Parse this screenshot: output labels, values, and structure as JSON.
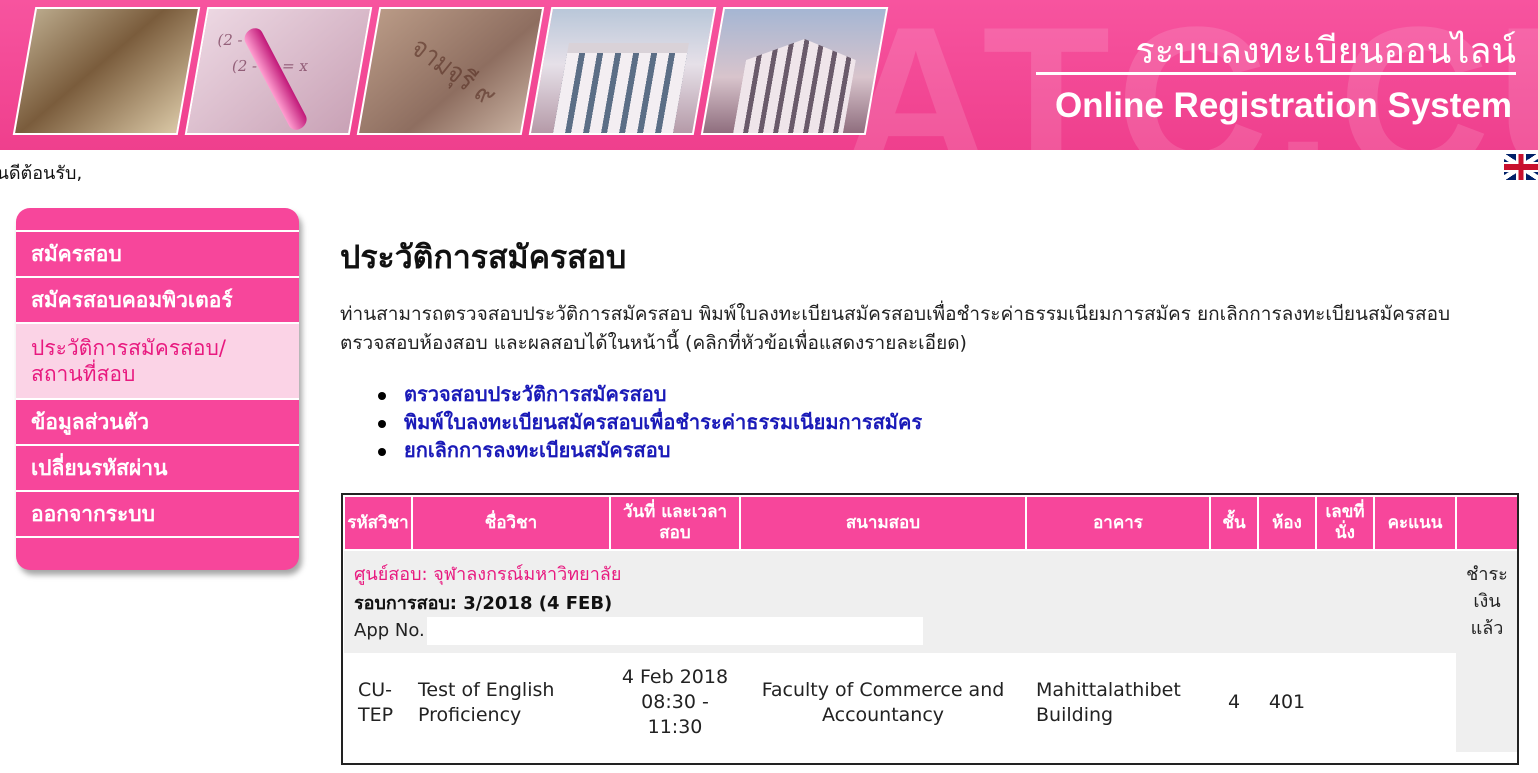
{
  "banner": {
    "bg_text": "ATC.CU",
    "title_th": "ระบบลงทะเบียนออนไลน์",
    "title_en": "Online Registration System",
    "panel_stone_text": "จามจุรี ๙",
    "panel_math_text": "(2 - 5)\n    (2 - 5̅) = x"
  },
  "welcome": "ยินดีต้อนรับ,",
  "language_icon": "uk-flag-icon",
  "sidebar": {
    "items": [
      {
        "label": "สมัครสอบ"
      },
      {
        "label": "สมัครสอบคอมพิวเตอร์"
      },
      {
        "label_line1": "ประวัติการสมัครสอบ/",
        "label_line2": "สถานที่สอบ"
      },
      {
        "label": "ข้อมูลส่วนตัว"
      },
      {
        "label": "เปลี่ยนรหัสผ่าน"
      },
      {
        "label": "ออกจากระบบ"
      }
    ]
  },
  "main": {
    "title": "ประวัติการสมัครสอบ",
    "description": "ท่านสามารถตรวจสอบประวัติการสมัครสอบ พิมพ์ใบลงทะเบียนสมัครสอบเพื่อชำระค่าธรรมเนียมการสมัคร ยกเลิกการลงทะเบียนสมัครสอบ ตรวจสอบห้องสอบ และผลสอบได้ในหน้านี้ (คลิกที่หัวข้อเพื่อแสดงรายละเอียด)",
    "links": [
      "ตรวจสอบประวัติการสมัครสอบ",
      "พิมพ์ใบลงทะเบียนสมัครสอบเพื่อชำระค่าธรรมเนียมการสมัคร",
      "ยกเลิกการลงทะเบียนสมัครสอบ"
    ]
  },
  "table": {
    "headers": {
      "code": "รหัสวิชา",
      "subject": "ชื่อวิชา",
      "datetime": "วันที่ และเวลาสอบ",
      "venue": "สนามสอบ",
      "building": "อาคาร",
      "floor": "ชั้น",
      "room": "ห้อง",
      "seat": "เลขที่นั่ง",
      "score": "คะแนน",
      "extra": ""
    },
    "center": {
      "name": "ศูนย์สอบ: จุฬาลงกรณ์มหาวิทยาลัย",
      "round": "รอบการสอบ: 3/2018 (4 FEB)",
      "app_no_label": "App No.",
      "paid_status": "ชำระเงินแล้ว"
    },
    "rows": [
      {
        "code": "CU-TEP",
        "subject": "Test of English Proficiency",
        "datetime": "4 Feb 2018 08:30 - 11:30",
        "venue": "Faculty of Commerce and Accountancy",
        "building": "Mahittalathibet Building",
        "floor": "4",
        "room": "401",
        "seat": "",
        "score": ""
      }
    ]
  },
  "colors": {
    "brand_pink": "#f7469b",
    "active_bg": "#fbd3e6",
    "active_text": "#e8197f",
    "link_blue": "#1a1ab8"
  }
}
